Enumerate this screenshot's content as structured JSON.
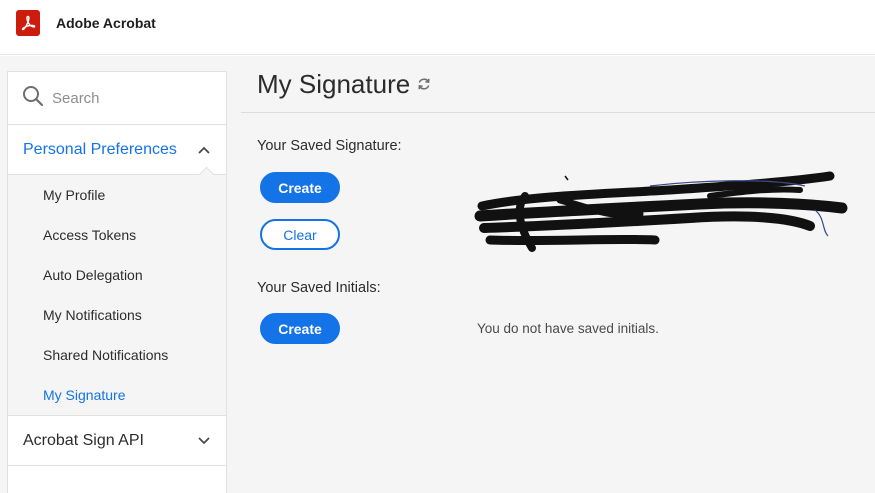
{
  "header": {
    "app_title": "Adobe Acrobat",
    "logo_icon": "acrobat-logo-icon"
  },
  "sidebar": {
    "search_placeholder": "Search",
    "sections": [
      {
        "title": "Personal Preferences",
        "expanded": true,
        "items": [
          {
            "label": "My Profile",
            "selected": false
          },
          {
            "label": "Access Tokens",
            "selected": false
          },
          {
            "label": "Auto Delegation",
            "selected": false
          },
          {
            "label": "My Notifications",
            "selected": false
          },
          {
            "label": "Shared Notifications",
            "selected": false
          },
          {
            "label": "My Signature",
            "selected": true
          }
        ]
      },
      {
        "title": "Acrobat Sign API",
        "expanded": false
      }
    ]
  },
  "main": {
    "page_title": "My Signature",
    "saved_signature_label": "Your Saved Signature:",
    "create_signature_button": "Create",
    "clear_signature_button": "Clear",
    "saved_initials_label": "Your Saved Initials:",
    "create_initials_button": "Create",
    "no_initials_message": "You do not have saved initials."
  },
  "colors": {
    "accent": "#1473e6",
    "brand": "#cc1c0d",
    "background": "#f5f5f5"
  }
}
